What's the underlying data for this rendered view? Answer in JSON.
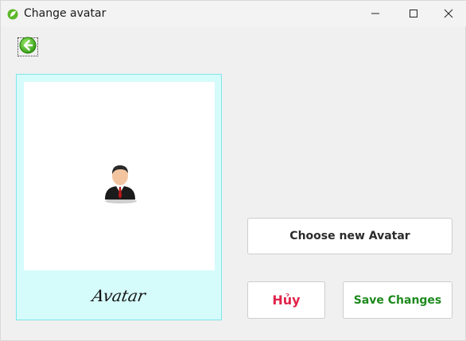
{
  "window": {
    "title": "Change avatar",
    "icon": "app-leaf-icon"
  },
  "titlebar_controls": {
    "minimize_icon": "minimize-icon",
    "maximize_icon": "maximize-icon",
    "close_icon": "close-icon"
  },
  "back_button": {
    "icon": "back-arrow-icon",
    "color": "#3cb01a"
  },
  "avatar_panel": {
    "caption": "Avatar",
    "image_icon": "person-avatar-icon",
    "background": "#d6fbfb"
  },
  "buttons": {
    "choose_label": "Choose new Avatar",
    "cancel_label": "Hủy",
    "save_label": "Save Changes",
    "cancel_color": "#e0244a",
    "save_color": "#1e8a1e"
  }
}
